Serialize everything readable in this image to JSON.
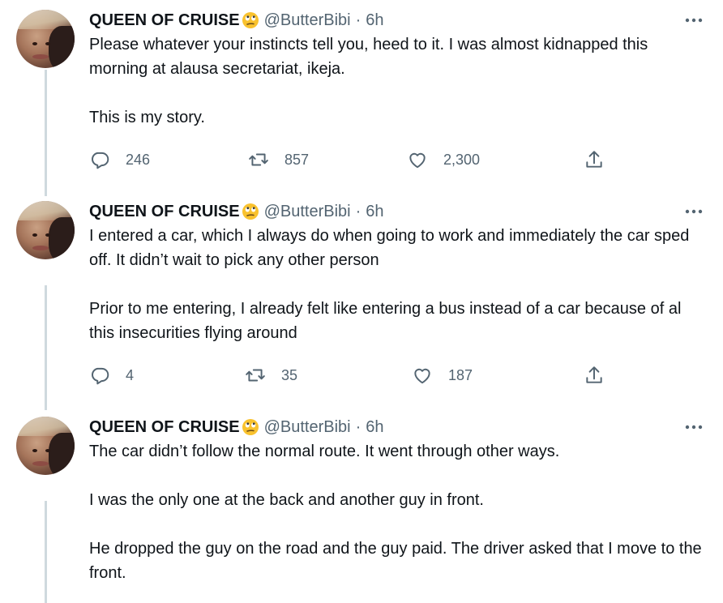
{
  "tweets": [
    {
      "display_name": "QUEEN OF CRUISE",
      "handle": "@ButterBibi",
      "separator": "·",
      "time": "6h",
      "paragraphs": [
        "Please whatever your instincts tell you, heed to it. I was almost kidnapped this morning at alausa secretariat, ikeja.",
        "This is my story."
      ],
      "replies": "246",
      "retweets": "857",
      "likes": "2,300"
    },
    {
      "display_name": "QUEEN OF CRUISE",
      "handle": "@ButterBibi",
      "separator": "·",
      "time": "6h",
      "paragraphs": [
        "I entered a car, which I always do when going to work and immediately the car sped off. It didn’t wait to pick any other person",
        "Prior to me entering, I already felt like entering a bus instead of a car because of al this insecurities flying around"
      ],
      "replies": "4",
      "retweets": "35",
      "likes": "187"
    },
    {
      "display_name": "QUEEN OF CRUISE",
      "handle": "@ButterBibi",
      "separator": "·",
      "time": "6h",
      "paragraphs": [
        "The car didn’t follow the normal route. It went through other ways.",
        "I was the only one at the back and another guy in front.",
        "He dropped the guy on the road and the guy paid. The driver asked that I move to the front."
      ]
    }
  ],
  "icons": {
    "reply": "reply-icon",
    "retweet": "retweet-icon",
    "like": "heart-icon",
    "share": "share-icon",
    "more": "more-icon",
    "emoji": "face-with-rolling-eyes-emoji"
  },
  "colors": {
    "text": "#0f1419",
    "secondary": "#536471",
    "thread_line": "#cfd9de",
    "emoji": "#f9c22e"
  }
}
